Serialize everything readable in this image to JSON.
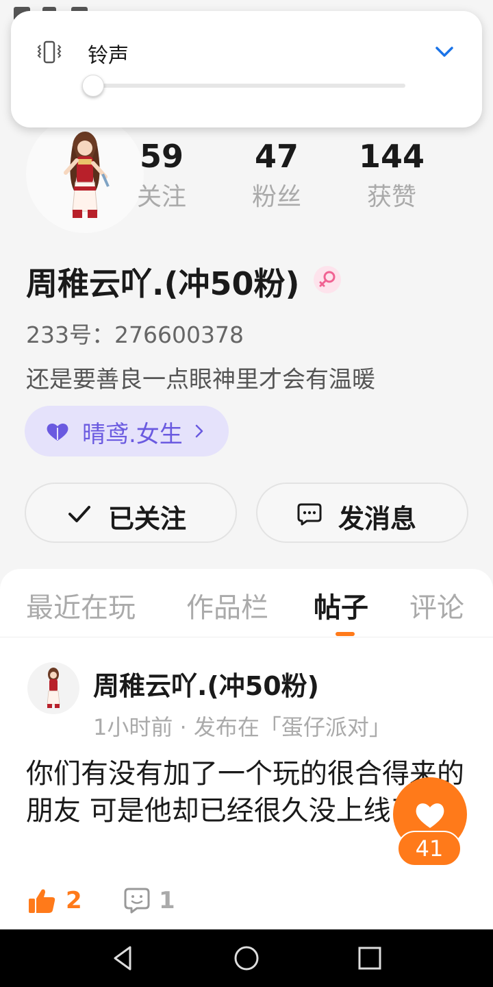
{
  "volume": {
    "label": "铃声",
    "level": 0.03,
    "icon": "vibrate-icon",
    "expand_icon": "chevron-down-icon",
    "accent": "#1a73e8"
  },
  "profile": {
    "stats": [
      {
        "value": "59",
        "label": "关注"
      },
      {
        "value": "47",
        "label": "粉丝"
      },
      {
        "value": "144",
        "label": "获赞"
      }
    ],
    "nickname": "周稚云吖.(冲50粉)",
    "gender_icon": "female-icon",
    "uid": "233号：276600378",
    "bio": "还是要善良一点眼神里才会有温暖",
    "tag": {
      "label": "晴鸢.女生",
      "icon": "heart-icon"
    },
    "buttons": {
      "follow": "已关注",
      "message": "发消息"
    }
  },
  "tabs": [
    {
      "label": "最近在玩",
      "active": false
    },
    {
      "label": "作品栏",
      "active": false
    },
    {
      "label": "帖子",
      "active": true
    },
    {
      "label": "评论",
      "active": false
    }
  ],
  "post": {
    "author": "周稚云吖.(冲50粉)",
    "meta": "1小时前 · 发布在「蛋仔派对」",
    "body": "你们有没有加了一个玩的很合得来的朋友 可是他却已经很久没上线了?",
    "likes": "2",
    "comments": "1"
  },
  "floating_like": {
    "count": "41"
  },
  "colors": {
    "accent": "#ff7a1a",
    "tag_bg": "#e5e2fb",
    "tag_text": "#6a5ae0"
  }
}
